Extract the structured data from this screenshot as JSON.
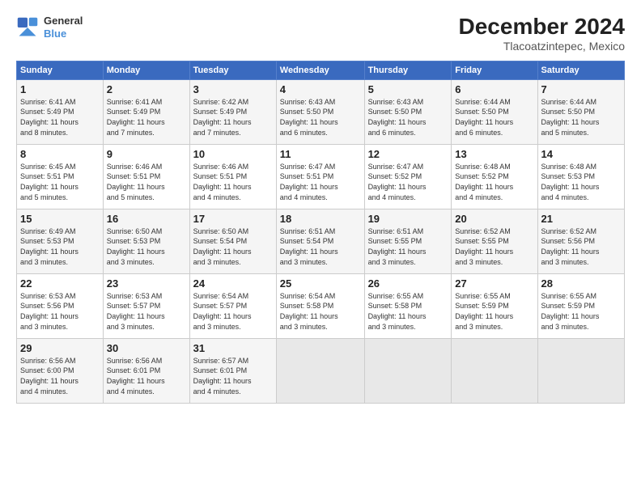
{
  "logo": {
    "line1": "General",
    "line2": "Blue"
  },
  "header": {
    "month": "December 2024",
    "location": "Tlacoatzintepec, Mexico"
  },
  "weekdays": [
    "Sunday",
    "Monday",
    "Tuesday",
    "Wednesday",
    "Thursday",
    "Friday",
    "Saturday"
  ],
  "weeks": [
    [
      {
        "day": "1",
        "info": "Sunrise: 6:41 AM\nSunset: 5:49 PM\nDaylight: 11 hours\nand 8 minutes."
      },
      {
        "day": "2",
        "info": "Sunrise: 6:41 AM\nSunset: 5:49 PM\nDaylight: 11 hours\nand 7 minutes."
      },
      {
        "day": "3",
        "info": "Sunrise: 6:42 AM\nSunset: 5:49 PM\nDaylight: 11 hours\nand 7 minutes."
      },
      {
        "day": "4",
        "info": "Sunrise: 6:43 AM\nSunset: 5:50 PM\nDaylight: 11 hours\nand 6 minutes."
      },
      {
        "day": "5",
        "info": "Sunrise: 6:43 AM\nSunset: 5:50 PM\nDaylight: 11 hours\nand 6 minutes."
      },
      {
        "day": "6",
        "info": "Sunrise: 6:44 AM\nSunset: 5:50 PM\nDaylight: 11 hours\nand 6 minutes."
      },
      {
        "day": "7",
        "info": "Sunrise: 6:44 AM\nSunset: 5:50 PM\nDaylight: 11 hours\nand 5 minutes."
      }
    ],
    [
      {
        "day": "8",
        "info": "Sunrise: 6:45 AM\nSunset: 5:51 PM\nDaylight: 11 hours\nand 5 minutes."
      },
      {
        "day": "9",
        "info": "Sunrise: 6:46 AM\nSunset: 5:51 PM\nDaylight: 11 hours\nand 5 minutes."
      },
      {
        "day": "10",
        "info": "Sunrise: 6:46 AM\nSunset: 5:51 PM\nDaylight: 11 hours\nand 4 minutes."
      },
      {
        "day": "11",
        "info": "Sunrise: 6:47 AM\nSunset: 5:51 PM\nDaylight: 11 hours\nand 4 minutes."
      },
      {
        "day": "12",
        "info": "Sunrise: 6:47 AM\nSunset: 5:52 PM\nDaylight: 11 hours\nand 4 minutes."
      },
      {
        "day": "13",
        "info": "Sunrise: 6:48 AM\nSunset: 5:52 PM\nDaylight: 11 hours\nand 4 minutes."
      },
      {
        "day": "14",
        "info": "Sunrise: 6:48 AM\nSunset: 5:53 PM\nDaylight: 11 hours\nand 4 minutes."
      }
    ],
    [
      {
        "day": "15",
        "info": "Sunrise: 6:49 AM\nSunset: 5:53 PM\nDaylight: 11 hours\nand 3 minutes."
      },
      {
        "day": "16",
        "info": "Sunrise: 6:50 AM\nSunset: 5:53 PM\nDaylight: 11 hours\nand 3 minutes."
      },
      {
        "day": "17",
        "info": "Sunrise: 6:50 AM\nSunset: 5:54 PM\nDaylight: 11 hours\nand 3 minutes."
      },
      {
        "day": "18",
        "info": "Sunrise: 6:51 AM\nSunset: 5:54 PM\nDaylight: 11 hours\nand 3 minutes."
      },
      {
        "day": "19",
        "info": "Sunrise: 6:51 AM\nSunset: 5:55 PM\nDaylight: 11 hours\nand 3 minutes."
      },
      {
        "day": "20",
        "info": "Sunrise: 6:52 AM\nSunset: 5:55 PM\nDaylight: 11 hours\nand 3 minutes."
      },
      {
        "day": "21",
        "info": "Sunrise: 6:52 AM\nSunset: 5:56 PM\nDaylight: 11 hours\nand 3 minutes."
      }
    ],
    [
      {
        "day": "22",
        "info": "Sunrise: 6:53 AM\nSunset: 5:56 PM\nDaylight: 11 hours\nand 3 minutes."
      },
      {
        "day": "23",
        "info": "Sunrise: 6:53 AM\nSunset: 5:57 PM\nDaylight: 11 hours\nand 3 minutes."
      },
      {
        "day": "24",
        "info": "Sunrise: 6:54 AM\nSunset: 5:57 PM\nDaylight: 11 hours\nand 3 minutes."
      },
      {
        "day": "25",
        "info": "Sunrise: 6:54 AM\nSunset: 5:58 PM\nDaylight: 11 hours\nand 3 minutes."
      },
      {
        "day": "26",
        "info": "Sunrise: 6:55 AM\nSunset: 5:58 PM\nDaylight: 11 hours\nand 3 minutes."
      },
      {
        "day": "27",
        "info": "Sunrise: 6:55 AM\nSunset: 5:59 PM\nDaylight: 11 hours\nand 3 minutes."
      },
      {
        "day": "28",
        "info": "Sunrise: 6:55 AM\nSunset: 5:59 PM\nDaylight: 11 hours\nand 3 minutes."
      }
    ],
    [
      {
        "day": "29",
        "info": "Sunrise: 6:56 AM\nSunset: 6:00 PM\nDaylight: 11 hours\nand 4 minutes."
      },
      {
        "day": "30",
        "info": "Sunrise: 6:56 AM\nSunset: 6:01 PM\nDaylight: 11 hours\nand 4 minutes."
      },
      {
        "day": "31",
        "info": "Sunrise: 6:57 AM\nSunset: 6:01 PM\nDaylight: 11 hours\nand 4 minutes."
      },
      null,
      null,
      null,
      null
    ]
  ]
}
